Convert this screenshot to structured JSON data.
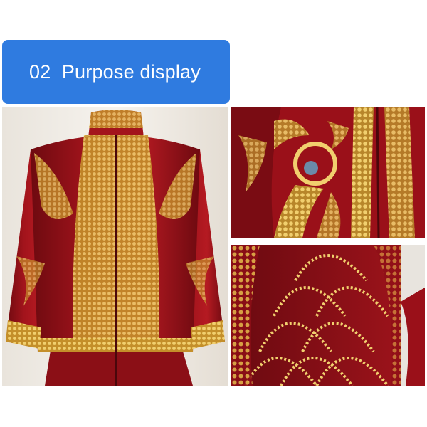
{
  "banner": {
    "number": "02",
    "title": "Purpose display"
  },
  "colors": {
    "banner_bg": "#2f7be0",
    "fabric_red": "#a3141c",
    "fabric_dark": "#6e0a10",
    "gold": "#d9a93a",
    "gold_light": "#f1cf6e"
  },
  "photos": [
    {
      "subject": "red velvet dress jacket with gold beaded embroidery, front view"
    },
    {
      "subject": "close-up of gold beaded phoenix embroidery"
    },
    {
      "subject": "close-up of gold beaded scallop pattern on sleeve"
    }
  ]
}
